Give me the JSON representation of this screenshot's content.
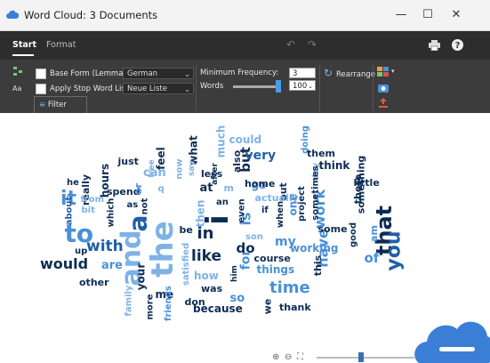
{
  "window": {
    "title": "Word Cloud: 3 Documents",
    "minimize": "—",
    "maximize": "☐",
    "close": "✕"
  },
  "ribbon": {
    "tabs": [
      {
        "label": "Start"
      },
      {
        "label": "Format"
      }
    ],
    "base_form_label": "Base Form (Lemmatize)",
    "base_form_value": "German",
    "stop_word_label": "Apply Stop Word List",
    "stop_word_value": "Neue Liste",
    "filter_label": "Filter",
    "min_freq_label": "Minimum Frequency:",
    "min_freq_value": "3",
    "words_label": "Words",
    "words_value": "100",
    "words_slider_fraction": 1.0,
    "rearrange_label": "Rearrange"
  },
  "zoom": {
    "slider_fraction": 0.45
  },
  "words": [
    {
      "text": "the",
      "size": 34,
      "color": "#7fb2e5",
      "rot": true
    },
    {
      "text": "and",
      "size": 30,
      "color": "#7fb2e5",
      "rot": true
    },
    {
      "text": "i",
      "size": 34,
      "color": "#0d2c54",
      "rot": true
    },
    {
      "text": "that",
      "size": 24,
      "color": "#0d2c54",
      "rot": true
    },
    {
      "text": "you",
      "size": 22,
      "color": "#1f5fa8",
      "rot": true
    },
    {
      "text": "to",
      "size": 28,
      "color": "#4a90d9",
      "rot": false
    },
    {
      "text": "a",
      "size": 28,
      "color": "#1f5fa8",
      "rot": true
    },
    {
      "text": "it",
      "size": 22,
      "color": "#4a90d9",
      "rot": false
    },
    {
      "text": "like",
      "size": 17,
      "color": "#0d2c54",
      "rot": false
    },
    {
      "text": "in",
      "size": 18,
      "color": "#0d2c54",
      "rot": false
    },
    {
      "text": "time",
      "size": 18,
      "color": "#4a90d9",
      "rot": false
    },
    {
      "text": "with",
      "size": 17,
      "color": "#1f5fa8",
      "rot": false
    },
    {
      "text": "would",
      "size": 16,
      "color": "#0d2c54",
      "rot": false
    },
    {
      "text": "work",
      "size": 16,
      "color": "#4a90d9",
      "rot": true
    },
    {
      "text": "have",
      "size": 16,
      "color": "#4a90d9",
      "rot": true
    },
    {
      "text": "is",
      "size": 16,
      "color": "#4a90d9",
      "rot": true
    },
    {
      "text": "but",
      "size": 15,
      "color": "#0d2c54",
      "rot": true
    },
    {
      "text": "very",
      "size": 14,
      "color": "#1f5fa8",
      "rot": false
    },
    {
      "text": "for",
      "size": 14,
      "color": "#4a90d9",
      "rot": true
    },
    {
      "text": "my",
      "size": 14,
      "color": "#4a90d9",
      "rot": false
    },
    {
      "text": "do",
      "size": 15,
      "color": "#0d2c54",
      "rot": false
    },
    {
      "text": "of",
      "size": 15,
      "color": "#4a90d9",
      "rot": false
    },
    {
      "text": "are",
      "size": 13,
      "color": "#4a90d9",
      "rot": false
    },
    {
      "text": "can",
      "size": 13,
      "color": "#7fb2e5",
      "rot": false
    },
    {
      "text": "feel",
      "size": 12,
      "color": "#0d2c54",
      "rot": true
    },
    {
      "text": "what",
      "size": 12,
      "color": "#0d2c54",
      "rot": true
    },
    {
      "text": "much",
      "size": 12,
      "color": "#7fb2e5",
      "rot": true
    },
    {
      "text": "could",
      "size": 12,
      "color": "#7fb2e5",
      "rot": false
    },
    {
      "text": "hours",
      "size": 12,
      "color": "#0d2c54",
      "rot": true
    },
    {
      "text": "really",
      "size": 11,
      "color": "#0d2c54",
      "rot": true
    },
    {
      "text": "just",
      "size": 11,
      "color": "#0d2c54",
      "rot": false
    },
    {
      "text": "spend",
      "size": 11,
      "color": "#0d2c54",
      "rot": false
    },
    {
      "text": "then",
      "size": 12,
      "color": "#7fb2e5",
      "rot": true
    },
    {
      "text": "at",
      "size": 13,
      "color": "#0d2c54",
      "rot": false
    },
    {
      "text": "so",
      "size": 13,
      "color": "#4a90d9",
      "rot": false
    },
    {
      "text": "how",
      "size": 12,
      "color": "#7fb2e5",
      "rot": false
    },
    {
      "text": "was",
      "size": 11,
      "color": "#0d2c54",
      "rot": false
    },
    {
      "text": "because",
      "size": 12,
      "color": "#0d2c54",
      "rot": false
    },
    {
      "text": "don",
      "size": 11,
      "color": "#0d2c54",
      "rot": false
    },
    {
      "text": "me",
      "size": 12,
      "color": "#0d2c54",
      "rot": false
    },
    {
      "text": "your",
      "size": 12,
      "color": "#0d2c54",
      "rot": true
    },
    {
      "text": "more",
      "size": 10,
      "color": "#0d2c54",
      "rot": true
    },
    {
      "text": "friends",
      "size": 10,
      "color": "#4a90d9",
      "rot": true
    },
    {
      "text": "family",
      "size": 10,
      "color": "#7fb2e5",
      "rot": true
    },
    {
      "text": "other",
      "size": 11,
      "color": "#0d2c54",
      "rot": false
    },
    {
      "text": "up",
      "size": 10,
      "color": "#0d2c54",
      "rot": false
    },
    {
      "text": "about",
      "size": 10,
      "color": "#1f5fa8",
      "rot": true
    },
    {
      "text": "he",
      "size": 10,
      "color": "#0d2c54",
      "rot": false
    },
    {
      "text": "bit",
      "size": 10,
      "color": "#7fb2e5",
      "rot": false
    },
    {
      "text": "which",
      "size": 10,
      "color": "#0d2c54",
      "rot": true
    },
    {
      "text": "from",
      "size": 10,
      "color": "#7fb2e5",
      "rot": false
    },
    {
      "text": "as",
      "size": 10,
      "color": "#0d2c54",
      "rot": false
    },
    {
      "text": "not",
      "size": 10,
      "color": "#0d2c54",
      "rot": true
    },
    {
      "text": "or",
      "size": 11,
      "color": "#4a90d9",
      "rot": true
    },
    {
      "text": "q",
      "size": 10,
      "color": "#7fb2e5",
      "rot": false
    },
    {
      "text": "free",
      "size": 9,
      "color": "#7fb2e5",
      "rot": true
    },
    {
      "text": "now",
      "size": 10,
      "color": "#7fb2e5",
      "rot": true
    },
    {
      "text": "say",
      "size": 9,
      "color": "#7fb2e5",
      "rot": true
    },
    {
      "text": "after",
      "size": 9,
      "color": "#0d2c54",
      "rot": true
    },
    {
      "text": "less",
      "size": 11,
      "color": "#0d2c54",
      "rot": false
    },
    {
      "text": "m",
      "size": 11,
      "color": "#7fb2e5",
      "rot": false
    },
    {
      "text": "also",
      "size": 11,
      "color": "#0d2c54",
      "rot": true
    },
    {
      "text": "an",
      "size": 10,
      "color": "#0d2c54",
      "rot": false
    },
    {
      "text": "be",
      "size": 11,
      "color": "#0d2c54",
      "rot": false
    },
    {
      "text": "satisfied",
      "size": 10,
      "color": "#7fb2e5",
      "rot": true
    },
    {
      "text": "him",
      "size": 9,
      "color": "#0d2c54",
      "rot": true
    },
    {
      "text": "son",
      "size": 10,
      "color": "#7fb2e5",
      "rot": false
    },
    {
      "text": "even",
      "size": 10,
      "color": "#0d2c54",
      "rot": true
    },
    {
      "text": "if",
      "size": 10,
      "color": "#0d2c54",
      "rot": false
    },
    {
      "text": "go",
      "size": 12,
      "color": "#4a90d9",
      "rot": false
    },
    {
      "text": "home",
      "size": 11,
      "color": "#0d2c54",
      "rot": false
    },
    {
      "text": "out",
      "size": 11,
      "color": "#0d2c54",
      "rot": true
    },
    {
      "text": "actually",
      "size": 11,
      "color": "#7fb2e5",
      "rot": false
    },
    {
      "text": "doing",
      "size": 10,
      "color": "#4a90d9",
      "rot": true
    },
    {
      "text": "them",
      "size": 11,
      "color": "#0d2c54",
      "rot": false
    },
    {
      "text": "think",
      "size": 12,
      "color": "#0d2c54",
      "rot": false
    },
    {
      "text": "day",
      "size": 10,
      "color": "#7fb2e5",
      "rot": true
    },
    {
      "text": "little",
      "size": 11,
      "color": "#0d2c54",
      "rot": false
    },
    {
      "text": "there",
      "size": 11,
      "color": "#0d2c54",
      "rot": true
    },
    {
      "text": "something",
      "size": 11,
      "color": "#0d2c54",
      "rot": true
    },
    {
      "text": "sometimes",
      "size": 10,
      "color": "#0d2c54",
      "rot": true
    },
    {
      "text": "project",
      "size": 10,
      "color": "#0d2c54",
      "rot": true
    },
    {
      "text": "when",
      "size": 10,
      "color": "#0d2c54",
      "rot": true
    },
    {
      "text": "one",
      "size": 12,
      "color": "#4a90d9",
      "rot": true
    },
    {
      "text": "some",
      "size": 11,
      "color": "#0d2c54",
      "rot": false
    },
    {
      "text": "working",
      "size": 12,
      "color": "#4a90d9",
      "rot": false
    },
    {
      "text": "this",
      "size": 11,
      "color": "#0d2c54",
      "rot": true
    },
    {
      "text": "course",
      "size": 11,
      "color": "#0d2c54",
      "rot": false
    },
    {
      "text": "things",
      "size": 12,
      "color": "#4a90d9",
      "rot": false
    },
    {
      "text": "good",
      "size": 10,
      "color": "#0d2c54",
      "rot": true
    },
    {
      "text": "am",
      "size": 11,
      "color": "#4a90d9",
      "rot": true
    },
    {
      "text": "thank",
      "size": 11,
      "color": "#0d2c54",
      "rot": false
    },
    {
      "text": "we",
      "size": 11,
      "color": "#0d2c54",
      "rot": true
    }
  ]
}
